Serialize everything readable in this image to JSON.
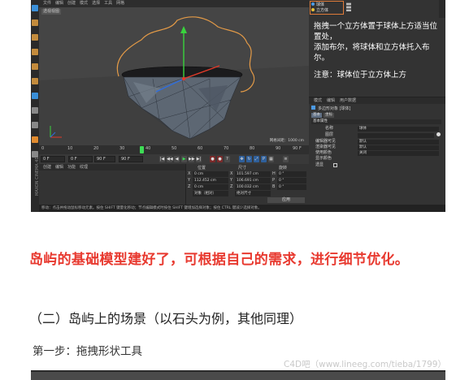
{
  "app": {
    "menu_items": [
      "文件",
      "编辑",
      "创建",
      "模式",
      "选择",
      "工具",
      "网格"
    ],
    "viewport_label": "透视视图",
    "grid_spacing": "网格间距：1000 cm"
  },
  "timeline": {
    "ticks": [
      "0",
      "10",
      "20",
      "30",
      "40",
      "50",
      "60",
      "70",
      "80",
      "90"
    ],
    "end_frame": "90 F",
    "current_frame": "0 F",
    "start_field": "0 F",
    "end_field": "90 F",
    "end_field_2": "90 F"
  },
  "material_panel": {
    "menu": [
      "创建",
      "编辑",
      "功能",
      "纹理"
    ],
    "brand_text": "MAXON CINEMA 4D"
  },
  "coordinates": {
    "headers": [
      "位置",
      "尺寸",
      "旋转"
    ],
    "rows": [
      {
        "axis": "X",
        "pos": "0 cm",
        "size": "101.597 cm",
        "rot_label": "H",
        "rot": "0 °"
      },
      {
        "axis": "Y",
        "pos": "112.452 cm",
        "size": "106.691 cm",
        "rot_label": "P",
        "rot": "0 °"
      },
      {
        "axis": "Z",
        "pos": "0 cm",
        "size": "100.032 cm",
        "rot_label": "B",
        "rot": "0 °"
      }
    ],
    "mode_select": "对象（相对）",
    "size_select": "绝对尺寸",
    "apply_label": "应用"
  },
  "status_text": "移动：点击并拖动鼠标移动元素。按住 SHIFT 键量化移动；节点编辑模式时按住 SHIFT 键增加选择对象；按住 CTRL 键减少选择对象。",
  "objects_panel": {
    "items": [
      {
        "name": "球体",
        "color": "#4c9be6"
      },
      {
        "name": "立方体",
        "color": "#e8c13a"
      }
    ],
    "instruction_lines": [
      "拖拽一个立方体置于球体上方适当位置处，",
      "添加布尔，将球体和立方体托入布尔。"
    ],
    "note": "注意：球体位于立方体上方"
  },
  "attributes": {
    "menu": [
      "模式",
      "编辑",
      "用户数据"
    ],
    "object_title": "多边形对象 [球体]",
    "tabs": [
      "基本",
      "坐标"
    ],
    "section": "基本属性",
    "fields": [
      {
        "label": "名称",
        "value": "球体"
      },
      {
        "label": "图层",
        "value": ""
      },
      {
        "label": "编辑器可见",
        "value": "默认"
      },
      {
        "label": "渲染器可见",
        "value": "默认"
      },
      {
        "label": "使用颜色",
        "value": "关闭"
      },
      {
        "label": "显示颜色",
        "value": ""
      },
      {
        "label": "透显",
        "value": ""
      }
    ]
  },
  "page": {
    "headline": "岛屿的基础模型建好了，可根据自己的需求，进行细节优化。",
    "section_title": "（二）岛屿上的场景（以石头为例，其他同理）",
    "step_text": "第一步：拖拽形状工具",
    "watermark": "C4D吧（www.lineeg.com/tieba/1799）"
  },
  "colors": {
    "headline": "#e8392f",
    "selection_outline": "#e07b39",
    "playhead": "#3ddc55"
  }
}
